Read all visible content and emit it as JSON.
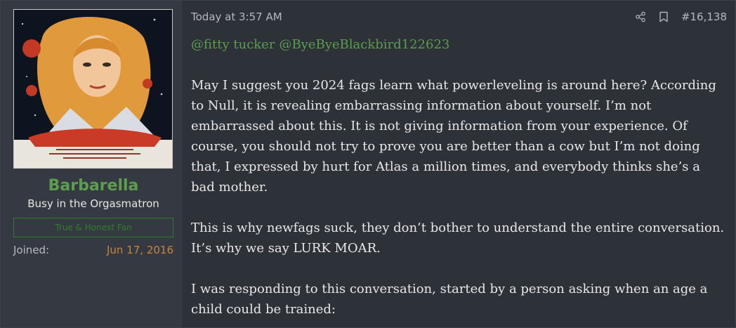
{
  "user": {
    "name": "Barbarella",
    "title": "Busy in the Orgasmatron",
    "banner": "True & Honest Fan",
    "joined_label": "Joined:",
    "joined_value": "Jun 17, 2016",
    "avatar_icon": "poster-avatar-image"
  },
  "post": {
    "timestamp": "Today at 3:57 AM",
    "share_icon": "share-icon",
    "bookmark_icon": "bookmark-icon",
    "number": "#16,138",
    "mentions": [
      "@fitty tucker",
      "@ByeByeBlackbird122623"
    ],
    "paragraphs": [
      "May I suggest you 2024 fags learn what powerleveling is around here? According to Null, it is revealing embarrassing information about yourself. I’m not embarrassed about this. It is not giving information from your experience. Of course, you should not try to prove you are better than a cow but I’m not doing that, I expressed by hurt for Atlas a million times, and everybody thinks she’s a bad mother.",
      "This is why newfags suck, they don’t bother to understand the entire conversation. It’s why we say LURK MOAR.",
      "I was responding to this conversation, started by a person asking when an age a child could be trained:"
    ]
  },
  "colors": {
    "accent_green": "#5c9e4d",
    "joined_orange": "#c7863e",
    "background": "#2d3138"
  }
}
